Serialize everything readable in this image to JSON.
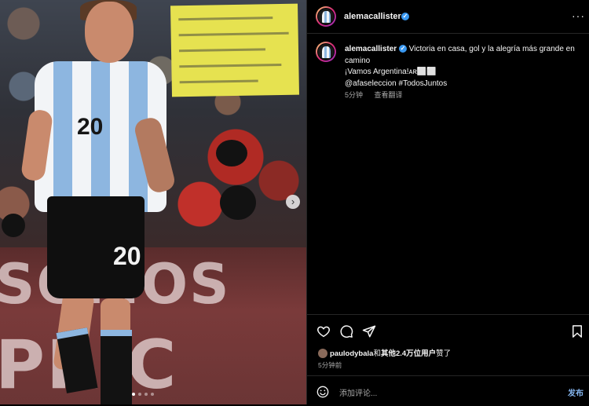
{
  "post": {
    "username": "alemacallister",
    "verified_mark": "✓",
    "caption_line1": "Victoria en casa, gol y la alegría más grande en camino",
    "caption_line2": "¡Vamos Argentina!ᴀʀ⬜⬜",
    "caption_line3": "@afaseleccion #TodosJuntos",
    "time_ago": "5分钟",
    "see_translation": "查看翻译",
    "more_icon": "more-horizontal-icon",
    "more_glyph": "···"
  },
  "media": {
    "shirt_number": "20",
    "shorts_number": "20",
    "banner_words": [
      "SOMOS",
      "PRIC"
    ],
    "next_glyph": "›",
    "carousel_total": 4,
    "carousel_active": 1
  },
  "actions": {
    "like_icon": "heart-icon",
    "comment_icon": "comment-icon",
    "share_icon": "send-icon",
    "save_icon": "bookmark-icon"
  },
  "likes": {
    "liker": "paulodybala",
    "connector": "和",
    "others": "其他2.4万位用户",
    "suffix": "赞了",
    "time": "5分钟前"
  },
  "comment": {
    "placeholder": "添加评论...",
    "post_label": "发布",
    "emoji_icon": "emoji-icon"
  },
  "colors": {
    "background": "#000000",
    "divider": "#262626",
    "verified": "#3897f0",
    "post_button": "#85b6f0",
    "muted_text": "#a8a8a8"
  }
}
